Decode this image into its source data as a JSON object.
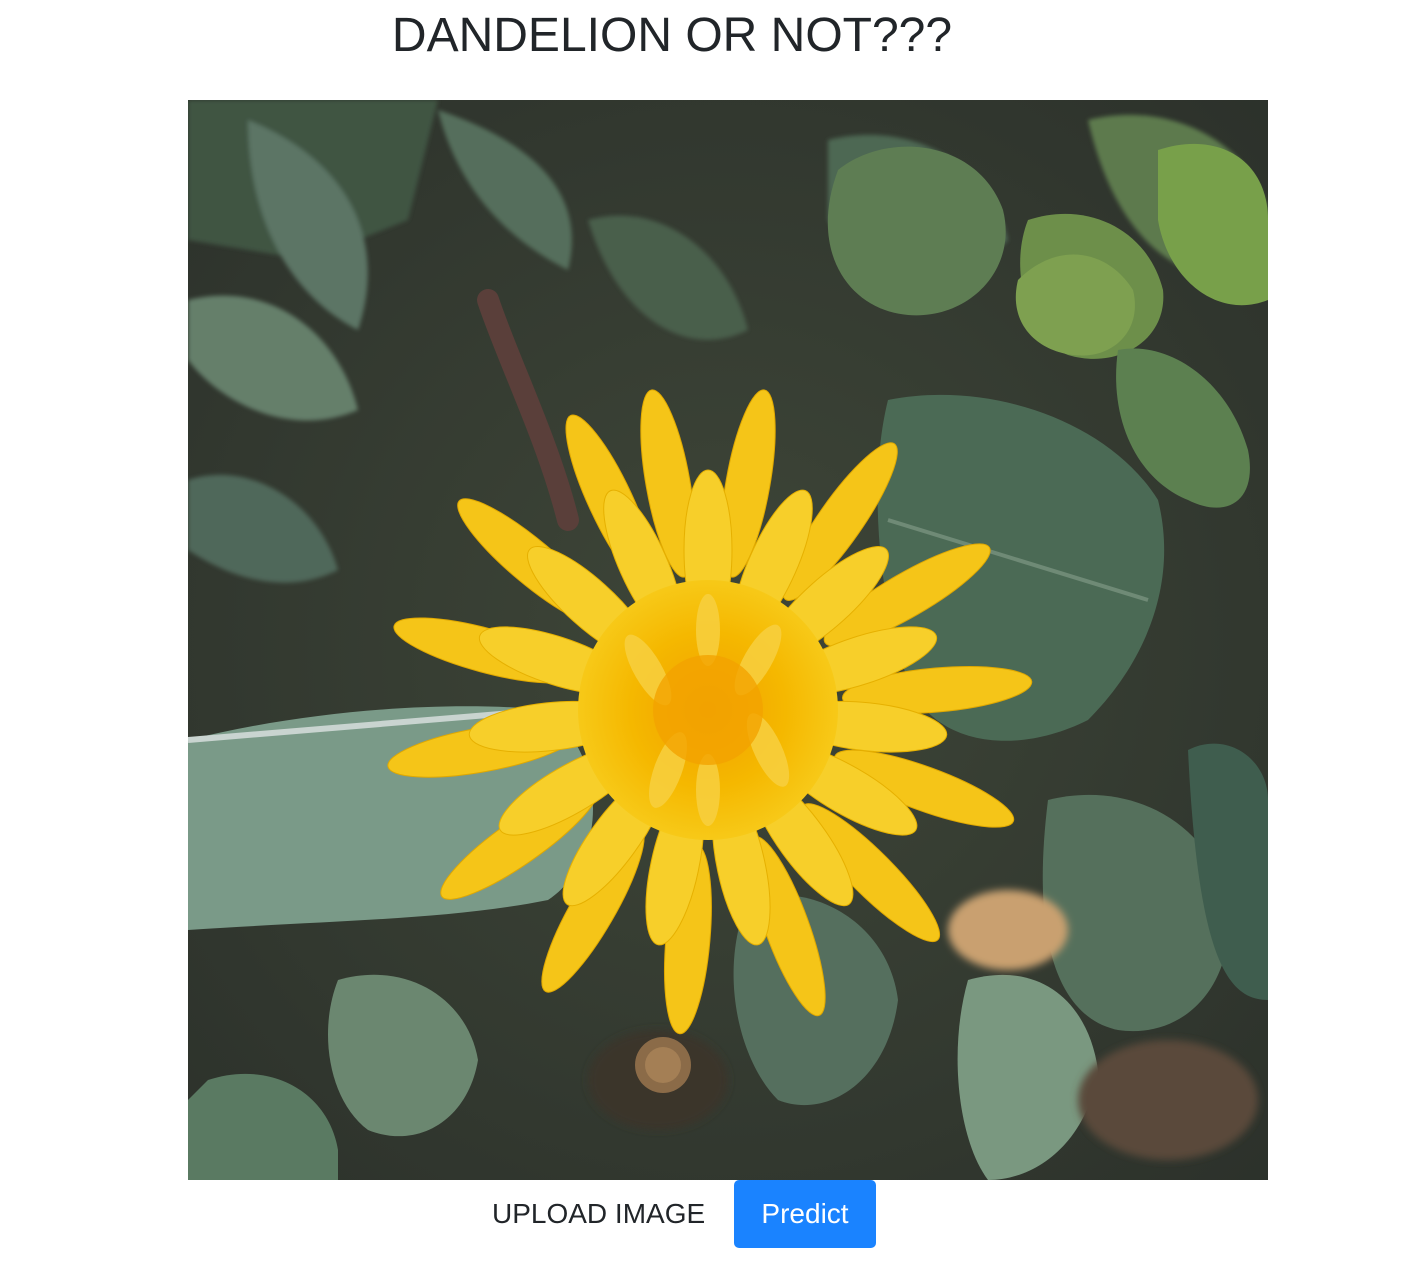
{
  "page": {
    "title": "DANDELION OR NOT???"
  },
  "image": {
    "subject": "dandelion-flower-photo",
    "colors": {
      "petal": "#f5c518",
      "center": "#f0a000",
      "leaf": "#4f6b50",
      "ground": "#3b3a30"
    }
  },
  "controls": {
    "upload_label": "UPLOAD IMAGE",
    "predict_label": "Predict",
    "predict_color": "#1a83ff"
  }
}
